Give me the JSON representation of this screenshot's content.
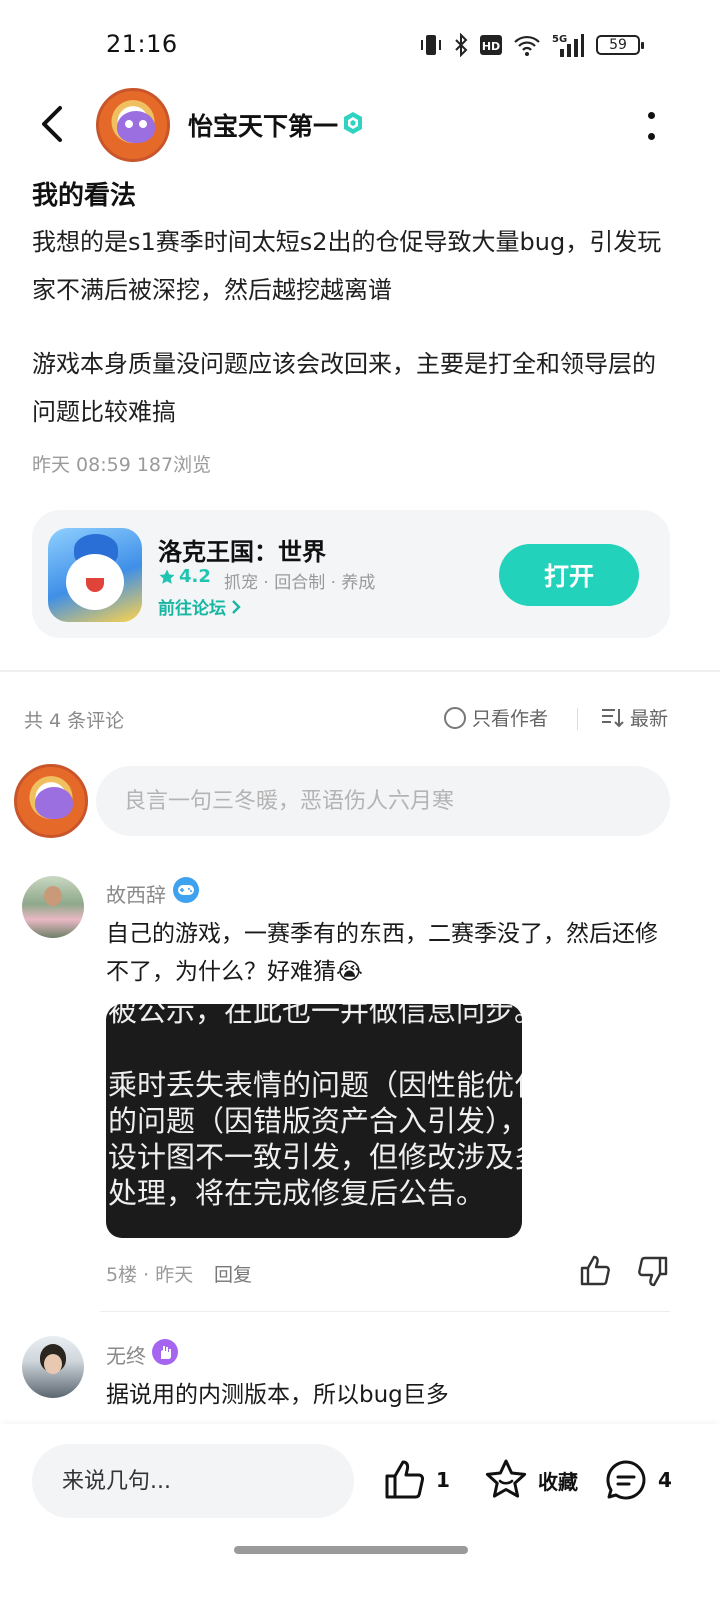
{
  "status_bar": {
    "time": "21:16",
    "battery": "59",
    "network": "5G"
  },
  "header": {
    "author_name": "怡宝天下第一"
  },
  "post": {
    "title": "我的看法",
    "paragraphs": [
      "我想的是s1赛季时间太短s2出的仓促导致大量bug，引发玩家不满后被深挖，然后越挖越离谱",
      "游戏本身质量没问题应该会改回来，主要是打全和领导层的问题比较难搞"
    ],
    "meta": "昨天 08:59  187浏览"
  },
  "game_card": {
    "name": "洛克王国：世界",
    "rating": "4.2",
    "tags": "抓宠 · 回合制 · 养成",
    "forum_link": "前往论坛",
    "open_label": "打开",
    "accent": "#22d2bb"
  },
  "comments_header": {
    "count": "共 4 条评论",
    "author_only": "只看作者",
    "sort": "最新"
  },
  "comment_input": {
    "placeholder": "良言一句三冬暖，恶语伤人六月寒"
  },
  "comments": [
    {
      "name": "故西辞",
      "badge_icon": "gamepad-icon",
      "text": "自己的游戏，一赛季有的东西，二赛季没了，然后还修不了，为什么？好难猜😭",
      "image_lines": [
        "被公示，在此也一并做信息同步。",
        "乘时丢失表情的问题（因性能优化",
        "的问题（因错版资产合入引发），",
        "设计图不一致引发，但修改涉及多",
        "处理，将在完成修复后公告。"
      ],
      "meta": "5楼 · 昨天",
      "reply_label": "回复"
    },
    {
      "name": "无终",
      "badge_icon": "hand-icon",
      "text": "据说用的内测版本，所以bug巨多"
    }
  ],
  "bottom_bar": {
    "placeholder": "来说几句...",
    "likes": "1",
    "favorite_label": "收藏",
    "comment_count": "4"
  }
}
